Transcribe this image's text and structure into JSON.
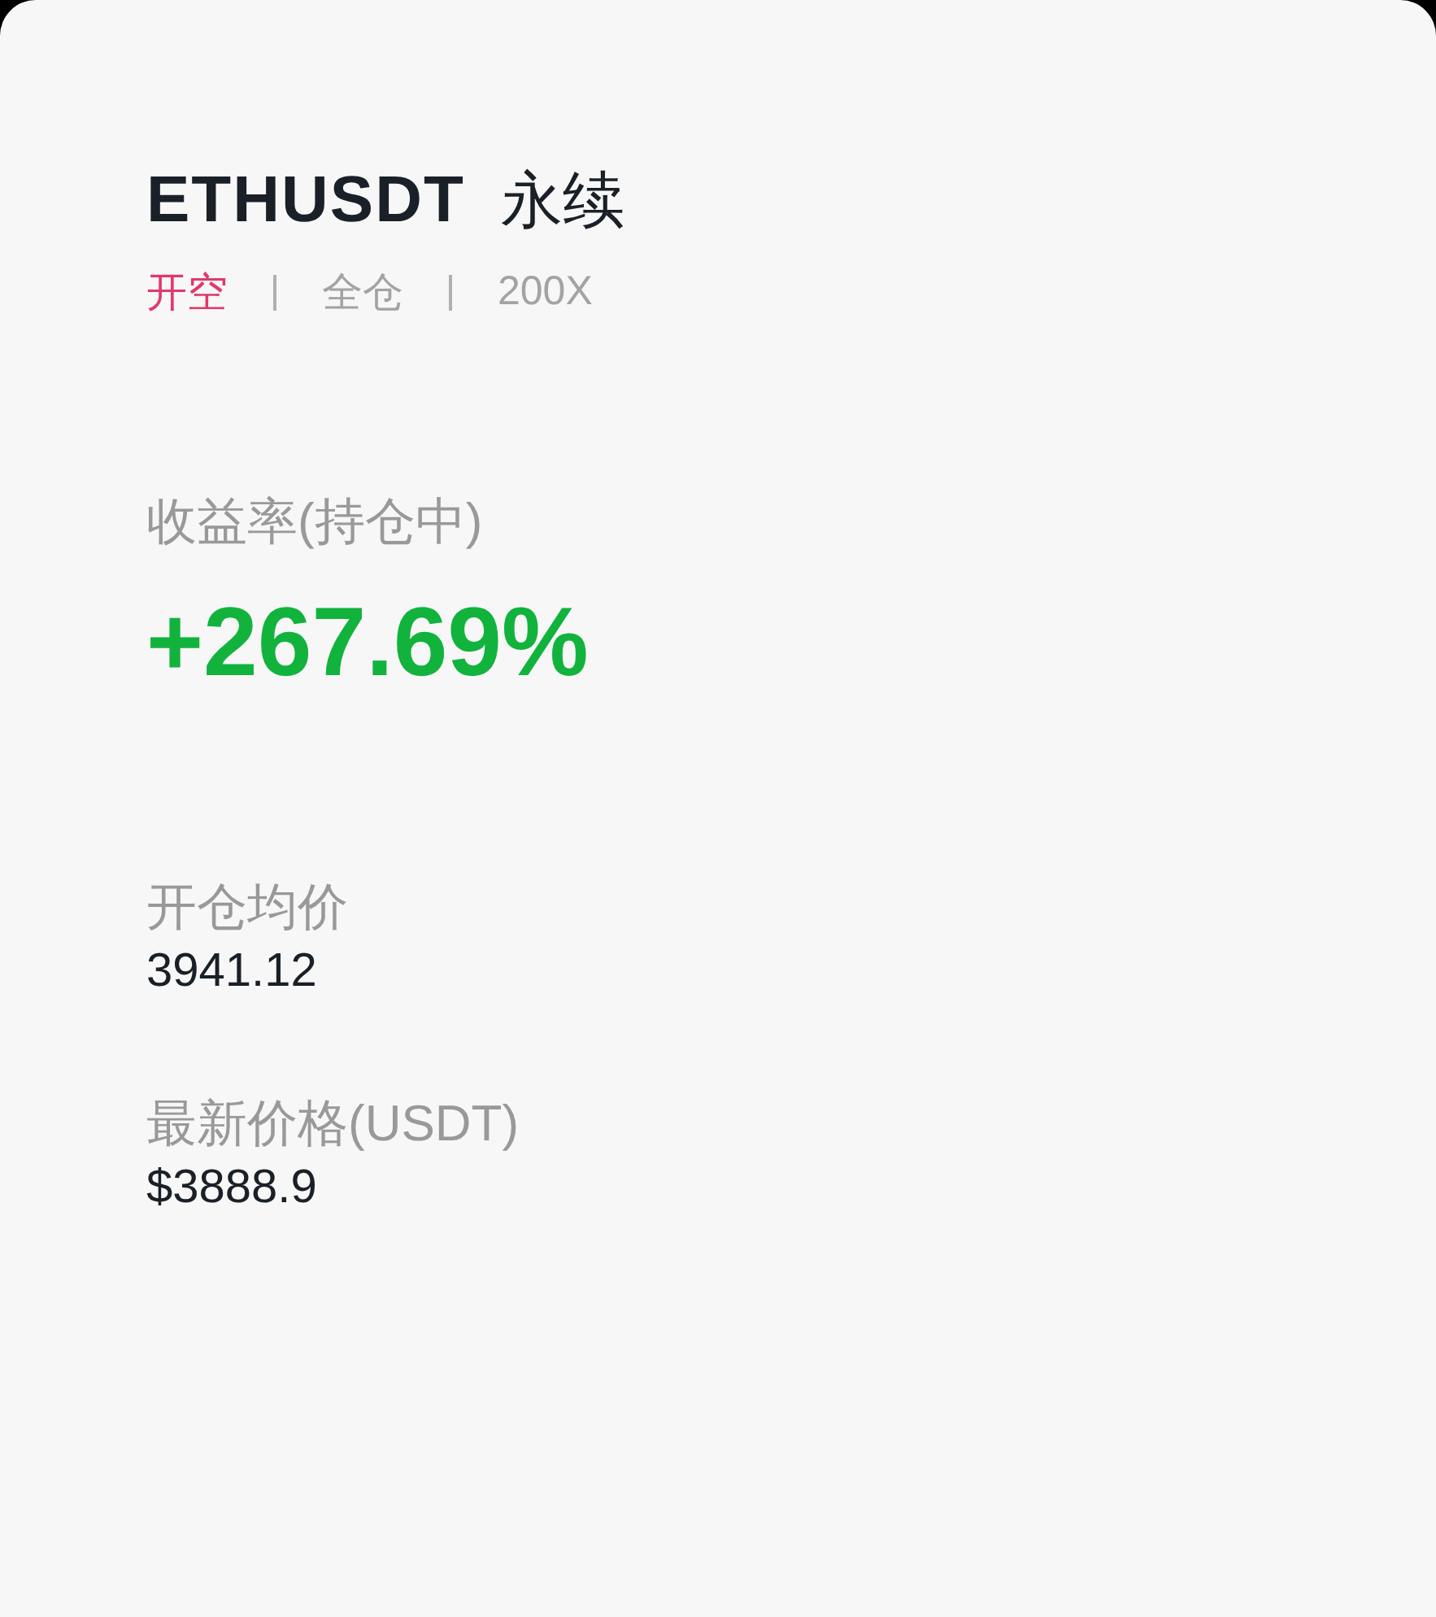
{
  "position": {
    "symbol": "ETHUSDT",
    "contract_type": "永续",
    "tags": [
      {
        "label": "开空",
        "color": "#e2386a"
      },
      {
        "label": "全仓",
        "color": "#a3a3a3"
      },
      {
        "label": "200X",
        "color": "#a3a3a3"
      }
    ]
  },
  "return_rate": {
    "label": "收益率(持仓中)",
    "value": "+267.69%"
  },
  "stats": [
    {
      "label": "开仓均价",
      "value": "3941.12"
    },
    {
      "label": "最新价格(USDT)",
      "value": "$3888.9"
    }
  ]
}
